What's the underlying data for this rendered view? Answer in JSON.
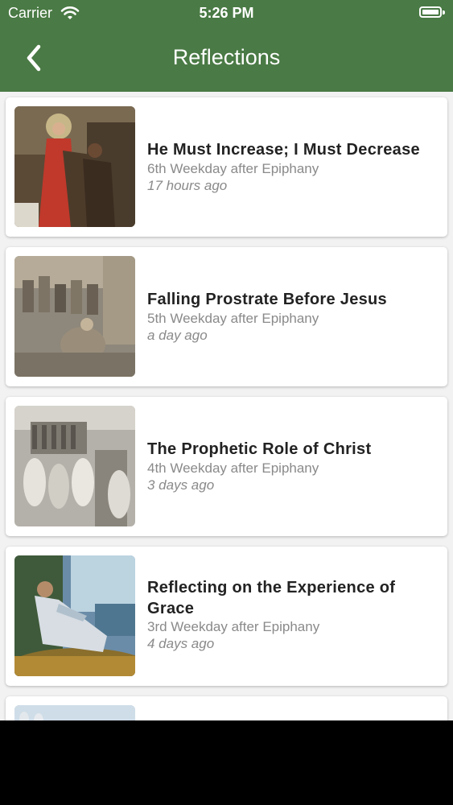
{
  "status_bar": {
    "carrier": "Carrier",
    "time": "5:26 PM"
  },
  "header": {
    "title": "Reflections",
    "back_icon": "chevron-left-icon",
    "background": "#4a7a45"
  },
  "reflections": [
    {
      "title": "He Must Increase; I Must Decrease",
      "subtitle": "6th Weekday after Epiphany",
      "time": "17 hours ago"
    },
    {
      "title": "Falling Prostrate Before Jesus",
      "subtitle": "5th Weekday after Epiphany",
      "time": "a day ago"
    },
    {
      "title": "The Prophetic Role of Christ",
      "subtitle": "4th Weekday after Epiphany",
      "time": "3 days ago"
    },
    {
      "title": "Reflecting on the Experience of Grace",
      "subtitle": "3rd Weekday after Epiphany",
      "time": "4 days ago"
    }
  ]
}
